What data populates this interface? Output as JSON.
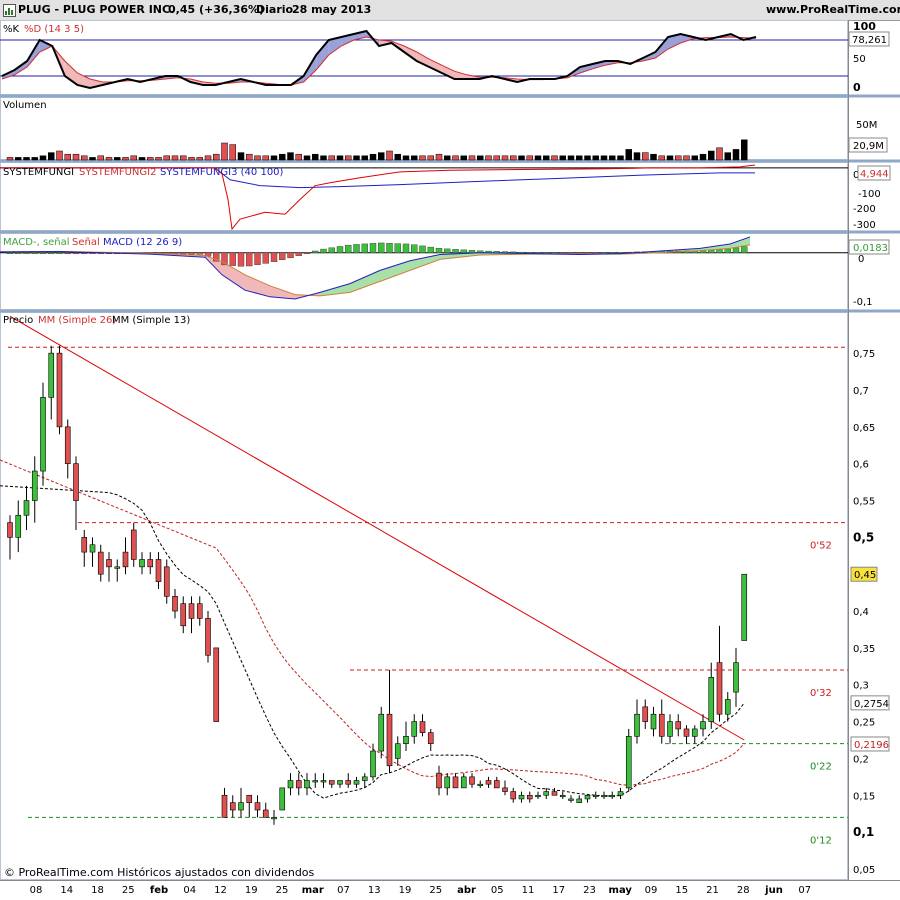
{
  "header": {
    "ticker": "PLUG - PLUG POWER INC.",
    "quote": "0,45 (+36,36%)",
    "period": "Diario",
    "date": "28 may 2013",
    "site": "www.ProRealTime.com"
  },
  "footer": {
    "copyright": "© ProRealTime.com  Históricos ajustados con dividendos"
  },
  "colors": {
    "up": "#3dbf3d",
    "down": "#e05050",
    "red_line": "#e00000",
    "blue_line": "#2020c0",
    "pane_separator": "#8fa8c8"
  },
  "chart_data": {
    "type": "candlestick",
    "x_axis": {
      "ticks": [
        "08",
        "14",
        "18",
        "25",
        "feb",
        "04",
        "12",
        "19",
        "25",
        "mar",
        "07",
        "13",
        "19",
        "25",
        "abr",
        "05",
        "11",
        "17",
        "23",
        "may",
        "09",
        "15",
        "21",
        "28",
        "jun",
        "07"
      ]
    },
    "panes": {
      "stochastic": {
        "label": "%K %D (14 3 5)",
        "label_k": "%K",
        "label_d": "%D (14 3 5)",
        "ylim": [
          0,
          100
        ],
        "ticks": [
          "100",
          "50",
          "0"
        ],
        "levels": [
          80,
          20
        ],
        "last": "78,261",
        "k": [
          20,
          30,
          45,
          80,
          70,
          20,
          5,
          0,
          5,
          10,
          15,
          10,
          15,
          20,
          20,
          10,
          5,
          5,
          10,
          15,
          10,
          5,
          5,
          5,
          20,
          55,
          80,
          85,
          90,
          95,
          70,
          75,
          60,
          45,
          35,
          25,
          15,
          15,
          15,
          20,
          15,
          10,
          15,
          15,
          15,
          20,
          35,
          40,
          45,
          45,
          40,
          50,
          60,
          85,
          90,
          85,
          80,
          85,
          90,
          80,
          85
        ],
        "d": [
          15,
          22,
          35,
          60,
          70,
          45,
          25,
          15,
          10,
          10,
          12,
          12,
          13,
          15,
          17,
          15,
          10,
          8,
          8,
          10,
          10,
          8,
          6,
          5,
          10,
          30,
          55,
          70,
          80,
          85,
          80,
          78,
          70,
          60,
          48,
          38,
          28,
          22,
          18,
          18,
          17,
          15,
          14,
          14,
          15,
          17,
          25,
          32,
          38,
          42,
          42,
          45,
          50,
          65,
          75,
          82,
          84,
          84,
          85,
          84,
          83
        ]
      },
      "volume": {
        "label": "Volumen",
        "ticks": [
          "50M"
        ],
        "last": "20,9M"
      },
      "systemfungi": {
        "label": "SYSTEMFUNGI SYSTEMFUNGI2 SYSTEMFUNGI3 (40 100)",
        "label_1": "SYSTEMFUNGI",
        "label_2": "SYSTEMFUNGI2",
        "label_3": "SYSTEMFUNGI3 (40 100)",
        "ylim": [
          -320,
          30
        ],
        "ticks": [
          "0",
          "-100",
          "-200",
          "-300"
        ],
        "last": "4,944"
      },
      "macd": {
        "label": "MACD-, señal Señal MACD (12 26 9)",
        "label_1": "MACD-, señal",
        "label_2": "Señal",
        "label_3": "MACD (12 26 9)",
        "ylim": [
          -0.13,
          0.045
        ],
        "ticks": [
          "0",
          "-0,1"
        ],
        "last": "0,0183"
      },
      "price": {
        "label": "Precio MM (Simple 26) MM (Simple 13)",
        "label_1": "Precio",
        "label_2": "MM (Simple 26)",
        "label_3": "MM (Simple 13)",
        "ylim": [
          0.035,
          0.795
        ],
        "ticks": [
          "0,75",
          "0,7",
          "0,65",
          "0,6",
          "0,55",
          "0,5",
          "0,45",
          "0,4",
          "0,35",
          "0,3",
          "0,25",
          "0,2",
          "0,15",
          "0,1",
          "0,05"
        ],
        "last_price": "0,45",
        "sma26_last": "0,2754",
        "sma13_last": "0,2196",
        "hlines": [
          {
            "value": 0.758,
            "label": ""
          },
          {
            "value": 0.52,
            "label": "0'52"
          },
          {
            "value": 0.32,
            "label": "0'32"
          },
          {
            "value": 0.22,
            "label": "0'22"
          },
          {
            "value": 0.12,
            "label": "0'12"
          }
        ],
        "trendline": {
          "from": [
            0,
            0.8
          ],
          "to": [
            89,
            0.225
          ]
        }
      }
    },
    "candles": [
      {
        "o": 0.52,
        "h": 0.53,
        "l": 0.47,
        "c": 0.5,
        "v": 1
      },
      {
        "o": 0.5,
        "h": 0.55,
        "l": 0.48,
        "c": 0.53,
        "v": 1
      },
      {
        "o": 0.53,
        "h": 0.57,
        "l": 0.51,
        "c": 0.55,
        "v": 1
      },
      {
        "o": 0.55,
        "h": 0.61,
        "l": 0.52,
        "c": 0.59,
        "v": 1
      },
      {
        "o": 0.59,
        "h": 0.71,
        "l": 0.57,
        "c": 0.69,
        "v": 2
      },
      {
        "o": 0.69,
        "h": 0.76,
        "l": 0.66,
        "c": 0.75,
        "v": 4
      },
      {
        "o": 0.75,
        "h": 0.76,
        "l": 0.64,
        "c": 0.65,
        "v": 5
      },
      {
        "o": 0.65,
        "h": 0.66,
        "l": 0.58,
        "c": 0.6,
        "v": 3
      },
      {
        "o": 0.6,
        "h": 0.61,
        "l": 0.51,
        "c": 0.55,
        "v": 3
      },
      {
        "o": 0.5,
        "h": 0.51,
        "l": 0.46,
        "c": 0.48,
        "v": 2
      },
      {
        "o": 0.48,
        "h": 0.5,
        "l": 0.46,
        "c": 0.49,
        "v": 1
      },
      {
        "o": 0.48,
        "h": 0.49,
        "l": 0.44,
        "c": 0.45,
        "v": 2
      },
      {
        "o": 0.47,
        "h": 0.48,
        "l": 0.44,
        "c": 0.46,
        "v": 1
      },
      {
        "o": 0.46,
        "h": 0.47,
        "l": 0.44,
        "c": 0.46,
        "v": 1
      },
      {
        "o": 0.48,
        "h": 0.5,
        "l": 0.45,
        "c": 0.46,
        "v": 1
      },
      {
        "o": 0.51,
        "h": 0.52,
        "l": 0.46,
        "c": 0.47,
        "v": 2
      },
      {
        "o": 0.46,
        "h": 0.48,
        "l": 0.45,
        "c": 0.47,
        "v": 1
      },
      {
        "o": 0.47,
        "h": 0.48,
        "l": 0.45,
        "c": 0.46,
        "v": 1
      },
      {
        "o": 0.47,
        "h": 0.48,
        "l": 0.43,
        "c": 0.44,
        "v": 1
      },
      {
        "o": 0.46,
        "h": 0.47,
        "l": 0.41,
        "c": 0.42,
        "v": 2
      },
      {
        "o": 0.42,
        "h": 0.43,
        "l": 0.39,
        "c": 0.4,
        "v": 2
      },
      {
        "o": 0.41,
        "h": 0.42,
        "l": 0.37,
        "c": 0.38,
        "v": 2
      },
      {
        "o": 0.41,
        "h": 0.42,
        "l": 0.37,
        "c": 0.39,
        "v": 1
      },
      {
        "o": 0.41,
        "h": 0.42,
        "l": 0.38,
        "c": 0.39,
        "v": 1
      },
      {
        "o": 0.39,
        "h": 0.4,
        "l": 0.33,
        "c": 0.34,
        "v": 2
      },
      {
        "o": 0.35,
        "h": 0.35,
        "l": 0.25,
        "c": 0.25,
        "v": 3
      },
      {
        "o": 0.15,
        "h": 0.16,
        "l": 0.12,
        "c": 0.12,
        "v": 10
      },
      {
        "o": 0.14,
        "h": 0.15,
        "l": 0.12,
        "c": 0.13,
        "v": 9
      },
      {
        "o": 0.13,
        "h": 0.16,
        "l": 0.12,
        "c": 0.14,
        "v": 4
      },
      {
        "o": 0.15,
        "h": 0.15,
        "l": 0.12,
        "c": 0.14,
        "v": 3
      },
      {
        "o": 0.14,
        "h": 0.15,
        "l": 0.12,
        "c": 0.13,
        "v": 2
      },
      {
        "o": 0.13,
        "h": 0.14,
        "l": 0.12,
        "c": 0.12,
        "v": 2
      },
      {
        "o": 0.12,
        "h": 0.13,
        "l": 0.11,
        "c": 0.12,
        "v": 2
      },
      {
        "o": 0.13,
        "h": 0.16,
        "l": 0.13,
        "c": 0.16,
        "v": 3
      },
      {
        "o": 0.16,
        "h": 0.18,
        "l": 0.15,
        "c": 0.17,
        "v": 4
      },
      {
        "o": 0.17,
        "h": 0.18,
        "l": 0.15,
        "c": 0.16,
        "v": 3
      },
      {
        "o": 0.16,
        "h": 0.18,
        "l": 0.15,
        "c": 0.17,
        "v": 2
      },
      {
        "o": 0.17,
        "h": 0.18,
        "l": 0.16,
        "c": 0.17,
        "v": 3
      },
      {
        "o": 0.17,
        "h": 0.18,
        "l": 0.16,
        "c": 0.17,
        "v": 2
      },
      {
        "o": 0.17,
        "h": 0.17,
        "l": 0.16,
        "c": 0.165,
        "v": 2
      },
      {
        "o": 0.165,
        "h": 0.17,
        "l": 0.16,
        "c": 0.17,
        "v": 2
      },
      {
        "o": 0.17,
        "h": 0.18,
        "l": 0.16,
        "c": 0.165,
        "v": 2
      },
      {
        "o": 0.165,
        "h": 0.175,
        "l": 0.16,
        "c": 0.17,
        "v": 2
      },
      {
        "o": 0.17,
        "h": 0.18,
        "l": 0.16,
        "c": 0.175,
        "v": 2
      },
      {
        "o": 0.175,
        "h": 0.22,
        "l": 0.17,
        "c": 0.21,
        "v": 3
      },
      {
        "o": 0.21,
        "h": 0.27,
        "l": 0.2,
        "c": 0.26,
        "v": 4
      },
      {
        "o": 0.26,
        "h": 0.32,
        "l": 0.18,
        "c": 0.19,
        "v": 5
      },
      {
        "o": 0.2,
        "h": 0.23,
        "l": 0.19,
        "c": 0.22,
        "v": 3
      },
      {
        "o": 0.22,
        "h": 0.25,
        "l": 0.21,
        "c": 0.23,
        "v": 2
      },
      {
        "o": 0.23,
        "h": 0.26,
        "l": 0.22,
        "c": 0.25,
        "v": 2
      },
      {
        "o": 0.25,
        "h": 0.26,
        "l": 0.23,
        "c": 0.235,
        "v": 2
      },
      {
        "o": 0.235,
        "h": 0.24,
        "l": 0.21,
        "c": 0.22,
        "v": 2
      },
      {
        "o": 0.18,
        "h": 0.19,
        "l": 0.15,
        "c": 0.16,
        "v": 3
      },
      {
        "o": 0.16,
        "h": 0.18,
        "l": 0.15,
        "c": 0.175,
        "v": 2
      },
      {
        "o": 0.175,
        "h": 0.18,
        "l": 0.16,
        "c": 0.16,
        "v": 2
      },
      {
        "o": 0.16,
        "h": 0.18,
        "l": 0.16,
        "c": 0.175,
        "v": 2
      },
      {
        "o": 0.175,
        "h": 0.18,
        "l": 0.16,
        "c": 0.165,
        "v": 2
      },
      {
        "o": 0.165,
        "h": 0.17,
        "l": 0.16,
        "c": 0.165,
        "v": 2
      },
      {
        "o": 0.17,
        "h": 0.175,
        "l": 0.16,
        "c": 0.165,
        "v": 2
      },
      {
        "o": 0.17,
        "h": 0.175,
        "l": 0.16,
        "c": 0.16,
        "v": 2
      },
      {
        "o": 0.16,
        "h": 0.17,
        "l": 0.15,
        "c": 0.155,
        "v": 2
      },
      {
        "o": 0.155,
        "h": 0.16,
        "l": 0.14,
        "c": 0.145,
        "v": 2
      },
      {
        "o": 0.145,
        "h": 0.155,
        "l": 0.14,
        "c": 0.15,
        "v": 2
      },
      {
        "o": 0.15,
        "h": 0.155,
        "l": 0.14,
        "c": 0.145,
        "v": 2
      },
      {
        "o": 0.15,
        "h": 0.155,
        "l": 0.145,
        "c": 0.15,
        "v": 2
      },
      {
        "o": 0.15,
        "h": 0.16,
        "l": 0.145,
        "c": 0.155,
        "v": 2
      },
      {
        "o": 0.155,
        "h": 0.16,
        "l": 0.15,
        "c": 0.15,
        "v": 2
      },
      {
        "o": 0.15,
        "h": 0.155,
        "l": 0.145,
        "c": 0.15,
        "v": 2
      },
      {
        "o": 0.145,
        "h": 0.15,
        "l": 0.14,
        "c": 0.145,
        "v": 2
      },
      {
        "o": 0.14,
        "h": 0.15,
        "l": 0.14,
        "c": 0.145,
        "v": 2
      },
      {
        "o": 0.145,
        "h": 0.15,
        "l": 0.14,
        "c": 0.15,
        "v": 2
      },
      {
        "o": 0.15,
        "h": 0.155,
        "l": 0.145,
        "c": 0.15,
        "v": 2
      },
      {
        "o": 0.15,
        "h": 0.155,
        "l": 0.145,
        "c": 0.15,
        "v": 2
      },
      {
        "o": 0.15,
        "h": 0.155,
        "l": 0.145,
        "c": 0.15,
        "v": 2
      },
      {
        "o": 0.15,
        "h": 0.16,
        "l": 0.145,
        "c": 0.155,
        "v": 2
      },
      {
        "o": 0.16,
        "h": 0.24,
        "l": 0.155,
        "c": 0.23,
        "v": 6
      },
      {
        "o": 0.23,
        "h": 0.28,
        "l": 0.22,
        "c": 0.26,
        "v": 4
      },
      {
        "o": 0.27,
        "h": 0.28,
        "l": 0.24,
        "c": 0.25,
        "v": 4
      },
      {
        "o": 0.24,
        "h": 0.27,
        "l": 0.23,
        "c": 0.26,
        "v": 3
      },
      {
        "o": 0.26,
        "h": 0.28,
        "l": 0.22,
        "c": 0.23,
        "v": 2
      },
      {
        "o": 0.23,
        "h": 0.26,
        "l": 0.22,
        "c": 0.25,
        "v": 2
      },
      {
        "o": 0.25,
        "h": 0.26,
        "l": 0.23,
        "c": 0.24,
        "v": 2
      },
      {
        "o": 0.24,
        "h": 0.245,
        "l": 0.22,
        "c": 0.23,
        "v": 2
      },
      {
        "o": 0.23,
        "h": 0.245,
        "l": 0.22,
        "c": 0.24,
        "v": 2
      },
      {
        "o": 0.24,
        "h": 0.26,
        "l": 0.23,
        "c": 0.25,
        "v": 3
      },
      {
        "o": 0.25,
        "h": 0.33,
        "l": 0.24,
        "c": 0.31,
        "v": 5
      },
      {
        "o": 0.33,
        "h": 0.38,
        "l": 0.25,
        "c": 0.26,
        "v": 7
      },
      {
        "o": 0.26,
        "h": 0.29,
        "l": 0.25,
        "c": 0.28,
        "v": 4
      },
      {
        "o": 0.29,
        "h": 0.35,
        "l": 0.27,
        "c": 0.33,
        "v": 6
      },
      {
        "o": 0.36,
        "h": 0.45,
        "l": 0.36,
        "c": 0.45,
        "v": 12
      }
    ]
  }
}
